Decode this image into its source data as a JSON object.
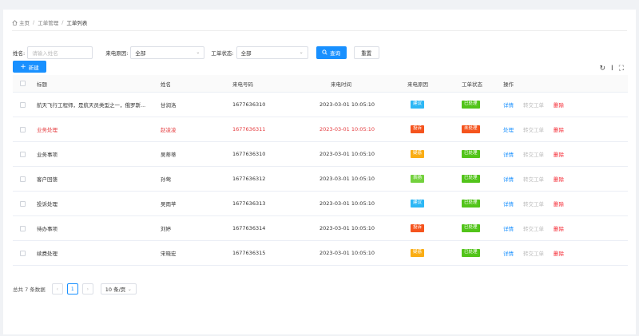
{
  "breadcrumb": {
    "home": "主页",
    "level1": "工单管理",
    "level2": "工单列表"
  },
  "filters": {
    "name_label": "姓名:",
    "name_placeholder": "请输入姓名",
    "reason_label": "来电原因:",
    "reason_value": "全部",
    "status_label": "工单状态:",
    "status_value": "全部",
    "search_label": "查询",
    "reset_label": "重置"
  },
  "toolbar": {
    "new_label": "新建"
  },
  "table": {
    "headers": [
      "标题",
      "姓名",
      "来电号码",
      "来电时间",
      "来电原因",
      "工单状态",
      "操作"
    ],
    "rows": [
      {
        "title": "航天飞行工程师，是航天员类型之一，俄罗斯...",
        "name": "甘润洛",
        "phone": "1677636310",
        "time": "2023-03-01 10:05:10",
        "reason": "建议",
        "reason_color": "#2db7f5",
        "status": "已处理",
        "status_color": "#52c41a",
        "op1": "详情",
        "op2": "转交工单",
        "op3": "删除",
        "highlight": false
      },
      {
        "title": "业务处理",
        "name": "赵凌凌",
        "phone": "1677636311",
        "time": "2023-03-01 10:05:10",
        "reason": "投诉",
        "reason_color": "#f5541e",
        "status": "未处理",
        "status_color": "#f5541e",
        "op1": "处理",
        "op2": "转交工单",
        "op3": "删除",
        "highlight": true
      },
      {
        "title": "业务事项",
        "name": "吴蒂蒂",
        "phone": "1677636310",
        "time": "2023-03-01 10:05:10",
        "reason": "疑惑",
        "reason_color": "#faad14",
        "status": "已处理",
        "status_color": "#52c41a",
        "op1": "详情",
        "op2": "转交工单",
        "op3": "删除",
        "highlight": false
      },
      {
        "title": "客户回馈",
        "name": "孙莺",
        "phone": "1677636312",
        "time": "2023-03-01 10:05:10",
        "reason": "表扬",
        "reason_color": "#73d13d",
        "status": "已处理",
        "status_color": "#52c41a",
        "op1": "详情",
        "op2": "转交工单",
        "op3": "删除",
        "highlight": false
      },
      {
        "title": "投诉处理",
        "name": "吴雨苹",
        "phone": "1677636313",
        "time": "2023-03-01 10:05:10",
        "reason": "建议",
        "reason_color": "#2db7f5",
        "status": "已处理",
        "status_color": "#52c41a",
        "op1": "详情",
        "op2": "转交工单",
        "op3": "删除",
        "highlight": false
      },
      {
        "title": "待办事项",
        "name": "刘婷",
        "phone": "1677636314",
        "time": "2023-03-01 10:05:10",
        "reason": "投诉",
        "reason_color": "#f5541e",
        "status": "已处理",
        "status_color": "#52c41a",
        "op1": "详情",
        "op2": "转交工单",
        "op3": "删除",
        "highlight": false
      },
      {
        "title": "续费处理",
        "name": "宋晓宏",
        "phone": "1677636315",
        "time": "2023-03-01 10:05:10",
        "reason": "疑惑",
        "reason_color": "#faad14",
        "status": "已处理",
        "status_color": "#52c41a",
        "op1": "详情",
        "op2": "转交工单",
        "op3": "删除",
        "highlight": false
      }
    ]
  },
  "pagination": {
    "total_text": "总共 7 条数据",
    "current_page": "1",
    "page_size": "10 条/页",
    "prev": "‹",
    "next": "›"
  },
  "tools": {
    "refresh": "↻",
    "density": "I",
    "fullscreen": "⛶"
  },
  "colors": {
    "primary": "#1890ff",
    "danger": "#f5222d",
    "highlight_text": "#e4393c"
  }
}
